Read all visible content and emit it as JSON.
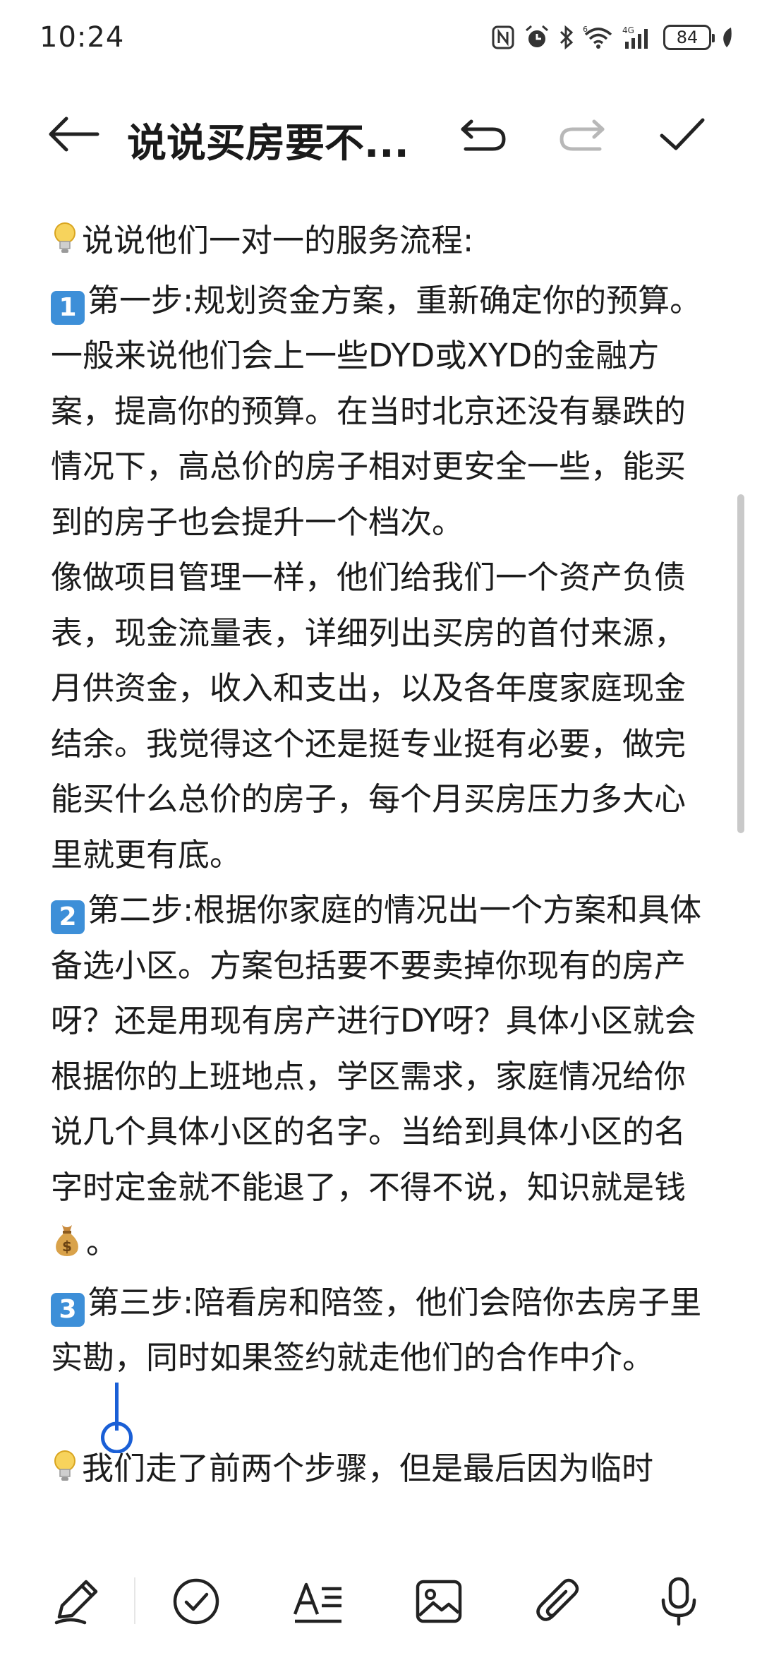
{
  "status_bar": {
    "time": "10:24",
    "battery": "84",
    "icons": [
      "nfc-icon",
      "alarm-icon",
      "bluetooth-icon",
      "wifi-6-icon",
      "4g-signal-icon",
      "battery-icon",
      "leaf-icon"
    ]
  },
  "header": {
    "title": "说说买房要不...",
    "back_icon": "back-arrow-icon",
    "undo_icon": "undo-icon",
    "redo_icon": "redo-icon",
    "done_icon": "check-icon"
  },
  "content": {
    "intro": "说说他们一对一的服务流程:",
    "step1_badge": "1",
    "step1": "第一步:规划资金方案，重新确定你的预算。一般来说他们会上一些DYD或XYD的金融方案，提高你的预算。在当时北京还没有暴跌的情况下，高总价的房子相对更安全一些，能买到的房子也会提升一个档次。",
    "step1_detail": "像做项目管理一样，他们给我们一个资产负债表，现金流量表，详细列出买房的首付来源，月供资金，收入和支出，以及各年度家庭现金结余。我觉得这个还是挺专业挺有必要，做完能买什么总价的房子，每个月买房压力多大心里就更有底。",
    "step2_badge": "2",
    "step2_a": "第二步:根据你家庭的情况出一个方案和具体备选小区。方案包括要不要卖掉你现有的房产呀？还是用现有房产进行DY呀？具体小区就会根据你的上班地点，学区需求，家庭情况给你说几个具体小区的名字。当给到具体小区的名字时定金就不能退了，不得不说，知识就是钱",
    "step2_b": "。",
    "step3_badge": "3",
    "step3": "第三步:陪看房和陪签，他们会陪你去房子里实勘，同时如果签约就走他们的合作中介。",
    "outro": "我们走了前两个步骤，但是最后因为临时"
  },
  "toolbar": {
    "items": [
      "pen-icon",
      "checklist-icon",
      "text-format-icon",
      "image-icon",
      "attachment-icon",
      "microphone-icon"
    ]
  },
  "colors": {
    "accent": "#1a5fd6",
    "keycap": "#3d8fd8",
    "text": "#1c1c1c"
  }
}
